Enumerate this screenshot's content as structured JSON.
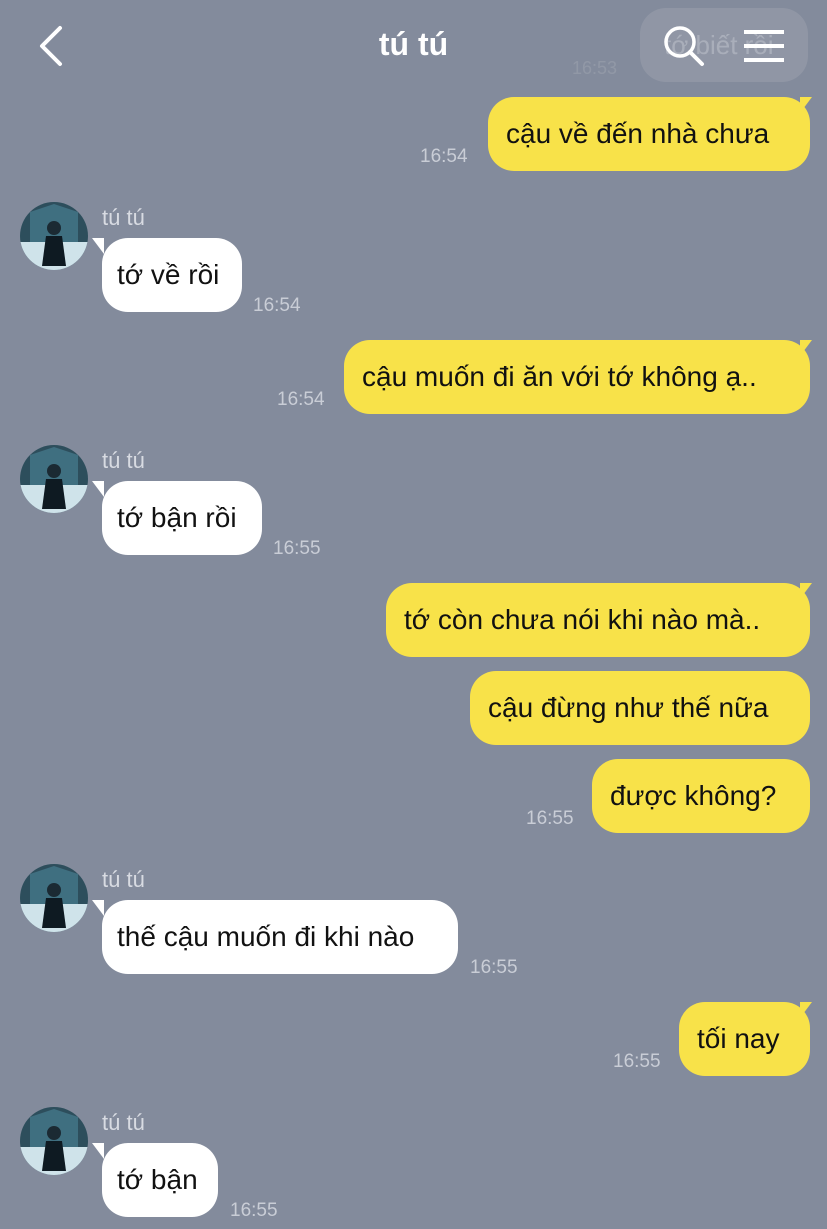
{
  "header": {
    "title": "tú tú",
    "ghost_text": "tớ biết rồi",
    "ghost_time": "16:53"
  },
  "messages": [
    {
      "dir": "out",
      "text": "cậu về đến nhà chưa",
      "time": "16:54"
    },
    {
      "dir": "in",
      "sender": "tú tú",
      "text": "tớ về rồi",
      "time": "16:54"
    },
    {
      "dir": "out",
      "text": "cậu muốn đi ăn với tớ không ạ..",
      "time": "16:54"
    },
    {
      "dir": "in",
      "sender": "tú tú",
      "text": "tớ bận rồi",
      "time": "16:55"
    },
    {
      "dir": "out",
      "text": "tớ còn chưa nói khi nào mà..",
      "time": ""
    },
    {
      "dir": "out",
      "text": "cậu đừng như thế nữa",
      "time": ""
    },
    {
      "dir": "out",
      "text": "được không?",
      "time": "16:55"
    },
    {
      "dir": "in",
      "sender": "tú tú",
      "text": "thế cậu muốn đi khi nào",
      "time": "16:55"
    },
    {
      "dir": "out",
      "text": "tối nay",
      "time": "16:55"
    },
    {
      "dir": "in",
      "sender": "tú tú",
      "text": "tớ bận",
      "time": "16:55"
    }
  ],
  "colors": {
    "background": "#838b9c",
    "outgoing_bubble": "#f8e249",
    "incoming_bubble": "#ffffff"
  },
  "icons": [
    "back-arrow-icon",
    "search-icon",
    "menu-icon",
    "avatar-image"
  ]
}
